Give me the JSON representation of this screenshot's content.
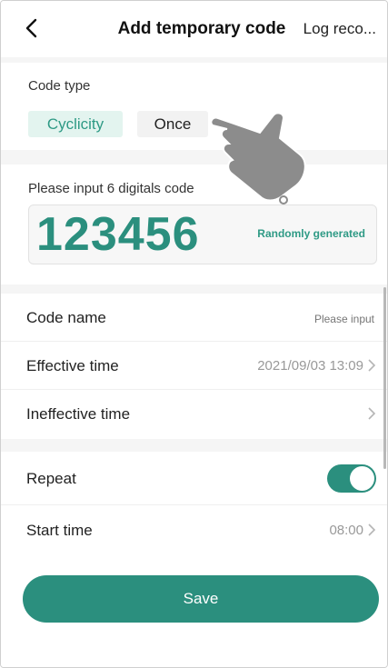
{
  "header": {
    "title": "Add temporary code",
    "log_link": "Log reco...",
    "back_icon": "chevron-left-icon"
  },
  "code_type": {
    "label": "Code type",
    "options": [
      "Cyclicity",
      "Once"
    ],
    "selected": "Cyclicity"
  },
  "code": {
    "label": "Please input 6 digitals code",
    "value": "123456",
    "random_label": "Randomly generated"
  },
  "fields": {
    "code_name": {
      "label": "Code name",
      "placeholder": "Please input"
    },
    "effective_time": {
      "label": "Effective time",
      "value": "2021/09/03 13:09"
    },
    "ineffective_time": {
      "label": "Ineffective time",
      "value": ""
    }
  },
  "repeat": {
    "label": "Repeat",
    "enabled": true
  },
  "start_time": {
    "label": "Start time",
    "value": "08:00"
  },
  "save_label": "Save",
  "colors": {
    "accent": "#2b8f7e",
    "chip_selected_bg": "#e3f4ef",
    "background": "#f5f5f5",
    "pointer_hand": "#8c8c8c"
  },
  "overlay_icon": "pointing-hand-icon"
}
